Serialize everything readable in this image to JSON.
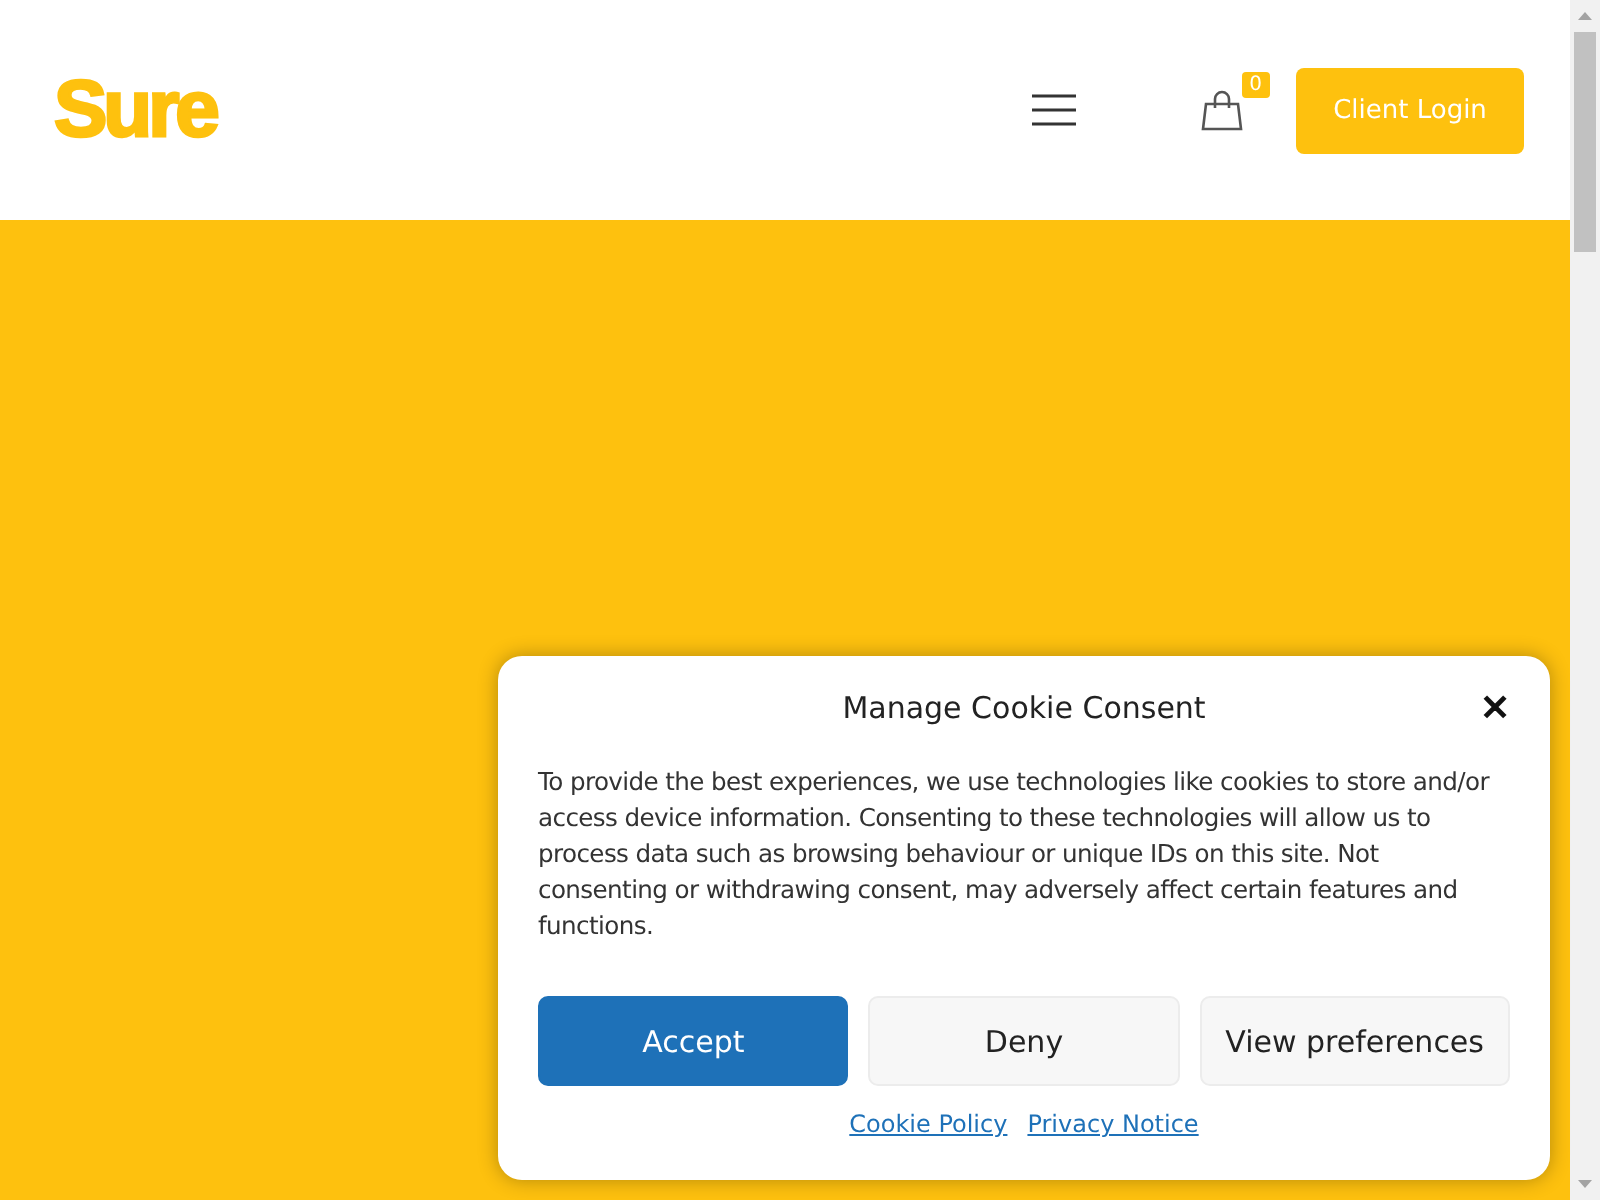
{
  "header": {
    "logo": "Sure",
    "cart_count": "0",
    "login_button": "Client Login"
  },
  "cookie_dialog": {
    "title": "Manage Cookie Consent",
    "close": "✕",
    "message": "To provide the best experiences, we use technologies like cookies to store and/or access device information. Consenting to these technologies will allow us to process data such as browsing behaviour or unique IDs on this site. Not consenting or withdrawing consent, may adversely affect certain features and functions.",
    "buttons": [
      {
        "label": "Accept",
        "kind": "primary"
      },
      {
        "label": "Deny",
        "kind": "secondary"
      },
      {
        "label": "View preferences",
        "kind": "secondary"
      }
    ],
    "links": [
      "Cookie Policy",
      "Privacy Notice"
    ]
  }
}
